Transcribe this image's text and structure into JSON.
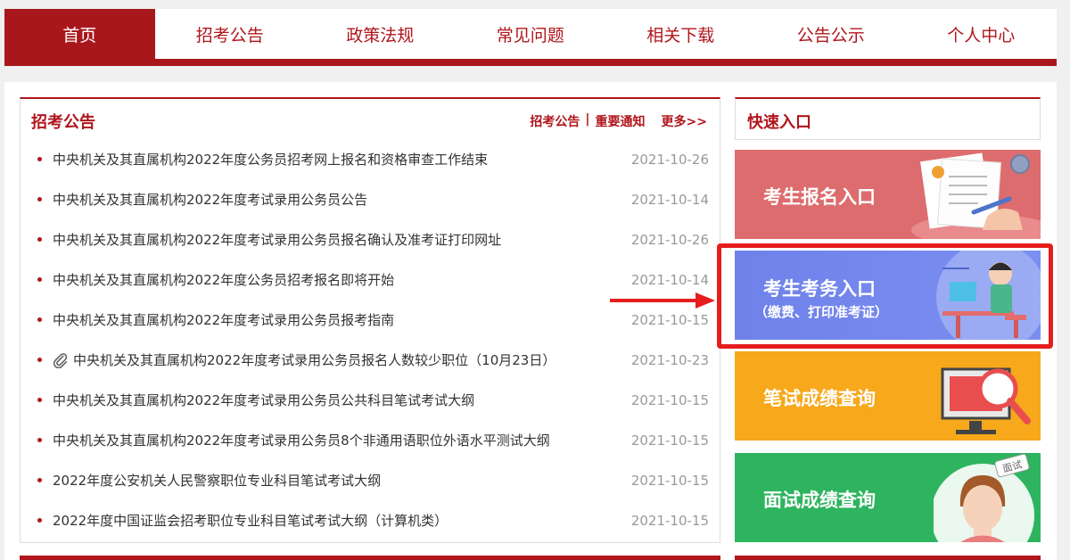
{
  "nav": {
    "items": [
      {
        "label": "首页",
        "active": true
      },
      {
        "label": "招考公告",
        "active": false
      },
      {
        "label": "政策法规",
        "active": false
      },
      {
        "label": "常见问题",
        "active": false
      },
      {
        "label": "相关下载",
        "active": false
      },
      {
        "label": "公告公示",
        "active": false
      },
      {
        "label": "个人中心",
        "active": false
      }
    ]
  },
  "notice": {
    "title": "招考公告",
    "link1": "招考公告",
    "separator": "|",
    "link2": "重要通知",
    "more": "更多>>",
    "items": [
      {
        "title": "中央机关及其直属机构2022年度公务员招考网上报名和资格审查工作结束",
        "date": "2021-10-26",
        "attachment": false
      },
      {
        "title": "中央机关及其直属机构2022年度考试录用公务员公告",
        "date": "2021-10-14",
        "attachment": false
      },
      {
        "title": "中央机关及其直属机构2022年度考试录用公务员报名确认及准考证打印网址",
        "date": "2021-10-26",
        "attachment": false
      },
      {
        "title": "中央机关及其直属机构2022年度公务员招考报名即将开始",
        "date": "2021-10-14",
        "attachment": false
      },
      {
        "title": "中央机关及其直属机构2022年度考试录用公务员报考指南",
        "date": "2021-10-15",
        "attachment": false
      },
      {
        "title": "中央机关及其直属机构2022年度考试录用公务员报名人数较少职位（10月23日）",
        "date": "2021-10-23",
        "attachment": true
      },
      {
        "title": "中央机关及其直属机构2022年度考试录用公务员公共科目笔试考试大纲",
        "date": "2021-10-15",
        "attachment": false
      },
      {
        "title": "中央机关及其直属机构2022年度考试录用公务员8个非通用语职位外语水平测试大纲",
        "date": "2021-10-15",
        "attachment": false
      },
      {
        "title": "2022年度公安机关人民警察职位专业科目笔试考试大纲",
        "date": "2021-10-15",
        "attachment": false
      },
      {
        "title": "2022年度中国证监会招考职位专业科目笔试考试大纲（计算机类）",
        "date": "2021-10-15",
        "attachment": false
      }
    ]
  },
  "quick": {
    "title": "快速入口",
    "cards": [
      {
        "label": "考生报名入口"
      },
      {
        "label": "考生考务入口",
        "sub": "（缴费、打印准考证）"
      },
      {
        "label": "笔试成绩查询"
      },
      {
        "label": "面试成绩查询",
        "badge": "面试"
      }
    ]
  },
  "colors": {
    "brand_red": "#a8171c",
    "card_registration": "#dd6c6e",
    "card_exam_affairs": "#7484ec",
    "card_written_score": "#f7a81b",
    "card_interview_score": "#2eb45f",
    "highlight": "#e61d1d"
  }
}
